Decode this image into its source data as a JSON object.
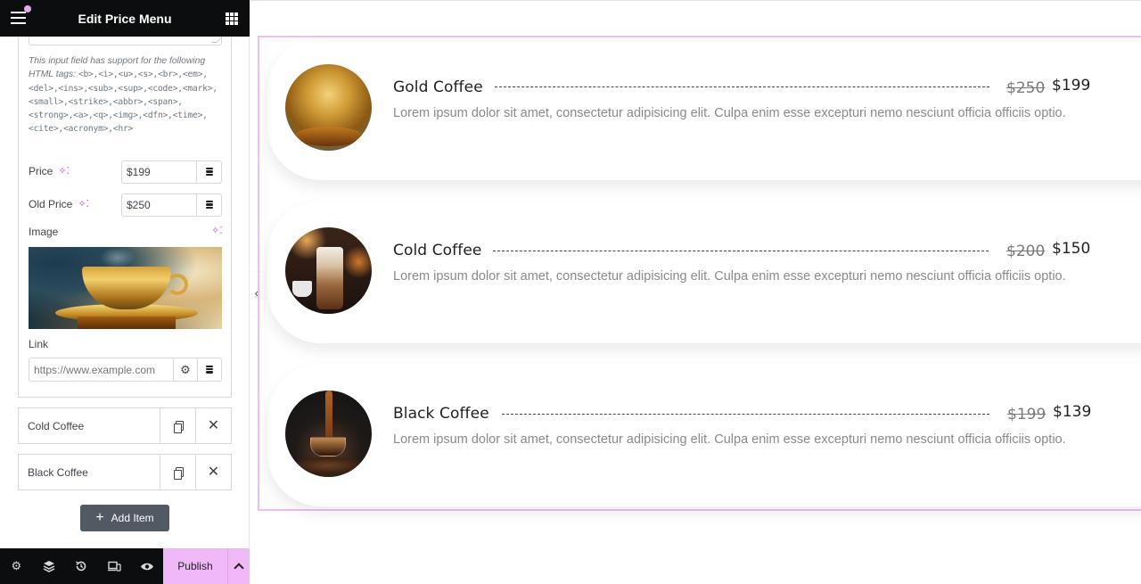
{
  "header": {
    "title": "Edit Price Menu",
    "menu_icon": "hamburger-icon",
    "apps_icon": "grid-icon",
    "notification_dot_color": "#e7a6f2"
  },
  "editor": {
    "help_text_prefix": "This input field has support for the following HTML tags: ",
    "help_text_tags": "<b>,<i>,<u>,<s>,<br>,<em>,<del>,<ins>,<sub>,<sup>,<code>,<mark>,<small>,<strike>,<abbr>,<span>,<strong>,<a>,<q>,<img>,<dfn>,<time>,<cite>,<acronym>,<hr>",
    "price_label": "Price",
    "price_value": "$199",
    "old_price_label": "Old Price",
    "old_price_value": "$250",
    "image_label": "Image",
    "link_label": "Link",
    "link_placeholder": "https://www.example.com",
    "ai_icon": "sparkle-icon",
    "dynamic_icon": "database-icon"
  },
  "repeater": {
    "items": [
      {
        "title": "Cold Coffee"
      },
      {
        "title": "Black Coffee"
      }
    ],
    "add_label": "Add Item"
  },
  "bottom_bar": {
    "icons": [
      "settings-icon",
      "layers-icon",
      "history-icon",
      "responsive-icon",
      "preview-icon"
    ],
    "publish_label": "Publish",
    "accent": "#f0b8f6"
  },
  "menu": {
    "items": [
      {
        "title": "Gold Coffee",
        "old_price": "$250",
        "price": "$199",
        "description": "Lorem ipsum dolor sit amet, consectetur adipisicing elit. Culpa enim esse excepturi nemo nesciunt officia officiis optio."
      },
      {
        "title": "Cold Coffee",
        "old_price": "$200",
        "price": "$150",
        "description": "Lorem ipsum dolor sit amet, consectetur adipisicing elit. Culpa enim esse excepturi nemo nesciunt officia officiis optio."
      },
      {
        "title": "Black Coffee",
        "old_price": "$199",
        "price": "$139",
        "description": "Lorem ipsum dolor sit amet, consectetur adipisicing elit. Culpa enim esse excepturi nemo nesciunt officia officiis optio."
      }
    ],
    "frame_color": "#efbdf4"
  }
}
